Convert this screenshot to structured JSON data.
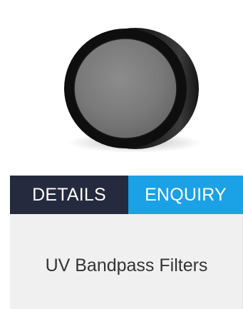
{
  "product": {
    "title": "UV Bandpass Filters",
    "image_icon": "circular-filter"
  },
  "actions": {
    "details_label": "DETAILS",
    "enquiry_label": "ENQUIRY"
  },
  "colors": {
    "details_bg": "#262a3f",
    "enquiry_bg": "#1ba1e6",
    "card_bg": "#f0f0f0",
    "title_text": "#333333"
  }
}
